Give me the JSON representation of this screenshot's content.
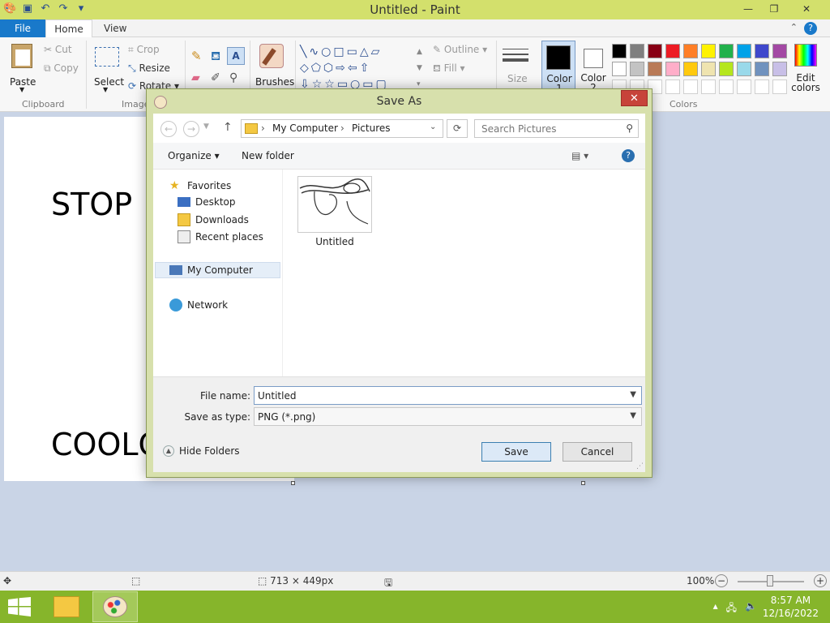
{
  "app": {
    "title": "Untitled - Paint",
    "min": "—",
    "max": "❐",
    "close": "✕"
  },
  "ribbon_tabs": {
    "file": "File",
    "home": "Home",
    "view": "View"
  },
  "ribbon": {
    "clipboard": {
      "paste": "Paste",
      "cut": "Cut",
      "copy": "Copy",
      "label": "Clipboard"
    },
    "image": {
      "select": "Select",
      "crop": "Crop",
      "resize": "Resize",
      "rotate": "Rotate",
      "label": "Image"
    },
    "tools": {
      "brushes": "Brushes"
    },
    "shapes": {
      "outline": "Outline",
      "fill": "Fill"
    },
    "size": "Size",
    "color1": "Color 1",
    "color2": "Color 2",
    "edit_colors": "Edit colors",
    "colors_label": "Colors",
    "palette": [
      "#000000",
      "#7f7f7f",
      "#880015",
      "#ed1c24",
      "#ff7f27",
      "#fff200",
      "#22b14c",
      "#00a2e8",
      "#3f48cc",
      "#a349a4",
      "#ffffff",
      "#c3c3c3",
      "#b97a57",
      "#ffaec9",
      "#ffc90e",
      "#efe4b0",
      "#b5e61d",
      "#99d9ea",
      "#7092be",
      "#c8bfe7",
      "#ffffff",
      "#ffffff",
      "#ffffff",
      "#ffffff",
      "#ffffff",
      "#ffffff",
      "#ffffff",
      "#ffffff",
      "#ffffff",
      "#ffffff"
    ]
  },
  "canvas": {
    "text1": "STOP",
    "text2": "COOLC"
  },
  "status": {
    "dimensions": "713 × 449px",
    "zoom": "100%"
  },
  "taskbar": {
    "time": "8:57 AM",
    "date": "12/16/2022"
  },
  "dialog": {
    "title": "Save As",
    "close": "✕",
    "address": {
      "root": "My Computer",
      "folder": "Pictures"
    },
    "search_placeholder": "Search Pictures",
    "toolbar": {
      "organize": "Organize",
      "new_folder": "New folder"
    },
    "nav": {
      "favorites": "Favorites",
      "desktop": "Desktop",
      "downloads": "Downloads",
      "recent": "Recent places",
      "computer": "My Computer",
      "network": "Network"
    },
    "files": [
      {
        "name": "Untitled"
      }
    ],
    "file_name_label": "File name:",
    "file_name_value": "Untitled",
    "save_type_label": "Save as type:",
    "save_type_value": "PNG (*.png)",
    "hide_folders": "Hide Folders",
    "save": "Save",
    "cancel": "Cancel"
  }
}
